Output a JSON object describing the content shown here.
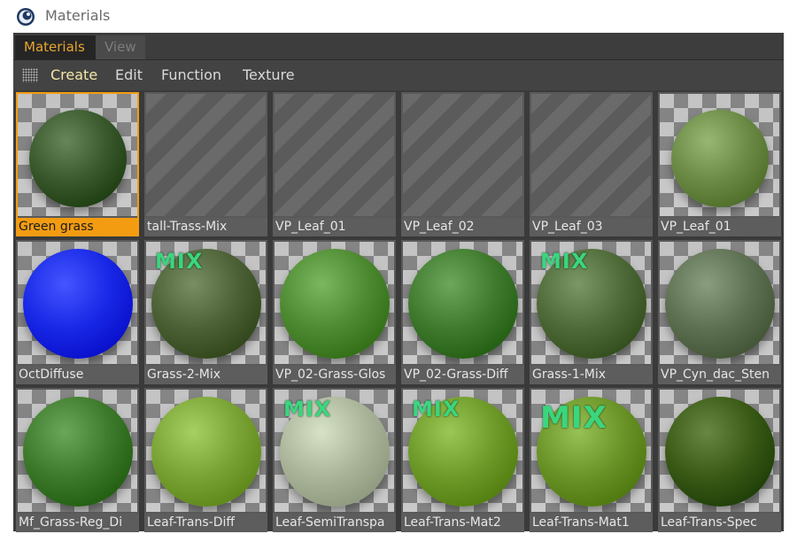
{
  "window": {
    "title": "Materials",
    "app_icon": "cinema4d-icon"
  },
  "tabs": [
    {
      "label": "Materials",
      "active": true
    },
    {
      "label": "View",
      "active": false
    }
  ],
  "menu": {
    "grip_icon": "grip-icon",
    "items": [
      "Create",
      "Edit",
      "Function",
      "Texture"
    ]
  },
  "colors": {
    "accent": "#f39c12",
    "active_tab_text": "#e8a530",
    "panel_bg": "#3a3a3a",
    "mix_label": "#3ad67e"
  },
  "materials": [
    {
      "name": "Green grass",
      "selected": true,
      "preview": "sphere",
      "color": "#3a5a2e",
      "mix": false
    },
    {
      "name": "tall-Trass-Mix",
      "selected": false,
      "preview": "empty",
      "mix": false
    },
    {
      "name": "VP_Leaf_01",
      "selected": false,
      "preview": "empty",
      "mix": false
    },
    {
      "name": "VP_Leaf_02",
      "selected": false,
      "preview": "empty",
      "mix": false
    },
    {
      "name": "VP_Leaf_03",
      "selected": false,
      "preview": "empty",
      "mix": false
    },
    {
      "name": "VP_Leaf_01",
      "selected": false,
      "preview": "sphere",
      "color": "#6a8a46",
      "mix": false
    },
    {
      "name": "OctDiffuse",
      "selected": false,
      "preview": "sphere",
      "color": "#1828e6",
      "mix": false
    },
    {
      "name": "Grass-2-Mix",
      "selected": false,
      "preview": "sphere",
      "color": "#4c6236",
      "mix": true,
      "mix_label": "MIX"
    },
    {
      "name": "VP_02-Grass-Glos",
      "selected": false,
      "preview": "sphere",
      "color": "#4e8a32",
      "mix": false
    },
    {
      "name": "VP_02-Grass-Diff",
      "selected": false,
      "preview": "sphere",
      "color": "#3f7a2e",
      "mix": false
    },
    {
      "name": "Grass-1-Mix",
      "selected": false,
      "preview": "sphere",
      "color": "#4e6a38",
      "mix": true,
      "mix_label": "MIX"
    },
    {
      "name": "VP_Cyn_dac_Sten",
      "selected": false,
      "preview": "sphere",
      "color": "#5e7052",
      "mix": false
    },
    {
      "name": "Mf_Grass-Reg_Di",
      "selected": false,
      "preview": "sphere",
      "color": "#3e7a2c",
      "mix": false
    },
    {
      "name": "Leaf-Trans-Diff",
      "selected": false,
      "preview": "sphere",
      "color": "#7aa336",
      "mix": false
    },
    {
      "name": "Leaf-SemiTranspa",
      "selected": false,
      "preview": "sphere",
      "color": "#aab59a",
      "mix": true,
      "mix_label": "MIX"
    },
    {
      "name": "Leaf-Trans-Mat2",
      "selected": false,
      "preview": "sphere",
      "color": "#6e9a2a",
      "mix": true,
      "mix_label": "MIX"
    },
    {
      "name": "Leaf-Trans-Mat1",
      "selected": false,
      "preview": "sphere",
      "color": "#6a9428",
      "mix": true,
      "mix_label": "MIX",
      "mix_big": true
    },
    {
      "name": "Leaf-Trans-Spec",
      "selected": false,
      "preview": "sphere",
      "color": "#3a5a16",
      "mix": false
    }
  ]
}
